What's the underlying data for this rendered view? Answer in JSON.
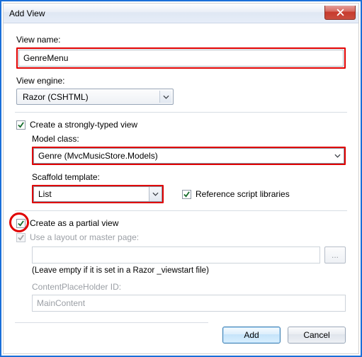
{
  "window": {
    "title": "Add View"
  },
  "viewName": {
    "label": "View name:",
    "value": "GenreMenu"
  },
  "viewEngine": {
    "label": "View engine:",
    "value": "Razor (CSHTML)"
  },
  "stronglyTyped": {
    "label": "Create a strongly-typed view",
    "checked": true
  },
  "modelClass": {
    "label": "Model class:",
    "value": "Genre (MvcMusicStore.Models)"
  },
  "scaffold": {
    "label": "Scaffold template:",
    "value": "List"
  },
  "refScripts": {
    "label": "Reference script libraries",
    "checked": true
  },
  "partial": {
    "label": "Create as a partial view",
    "checked": true
  },
  "layout": {
    "label": "Use a layout or master page:",
    "checked": true,
    "path": "",
    "hint": "(Leave empty if it is set in a Razor _viewstart file)"
  },
  "placeholder": {
    "label": "ContentPlaceHolder ID:",
    "value": "MainContent"
  },
  "buttons": {
    "browse": "...",
    "add": "Add",
    "cancel": "Cancel"
  }
}
